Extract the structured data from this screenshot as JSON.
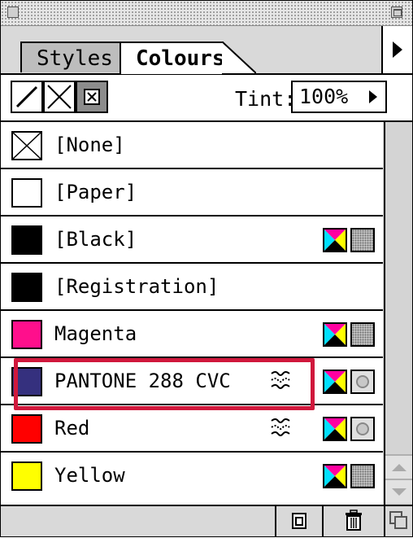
{
  "tabs": [
    {
      "label": "Styles",
      "active": false
    },
    {
      "label": "Colours",
      "active": true
    }
  ],
  "toolbar": {
    "tools": [
      "stroke-tool-icon",
      "no-fill-tool-icon",
      "fill-tool-icon"
    ],
    "tint_label": "Tint:",
    "tint_value": "100%"
  },
  "colours": [
    {
      "name": "[None]",
      "swatch": "none",
      "spot": false,
      "process": false,
      "mode": ""
    },
    {
      "name": "[Paper]",
      "swatch": "#ffffff",
      "spot": false,
      "process": false,
      "mode": ""
    },
    {
      "name": "[Black]",
      "swatch": "#000000",
      "spot": false,
      "process": true,
      "mode": "tone"
    },
    {
      "name": "[Registration]",
      "swatch": "#000000",
      "spot": false,
      "process": false,
      "mode": ""
    },
    {
      "name": "Magenta",
      "swatch": "#ff0f8c",
      "spot": false,
      "process": true,
      "mode": "tone"
    },
    {
      "name": "PANTONE 288 CVC",
      "swatch": "#35307e",
      "spot": true,
      "process": true,
      "mode": "dot",
      "highlighted": true
    },
    {
      "name": "Red",
      "swatch": "#ff0000",
      "spot": true,
      "process": true,
      "mode": "dot"
    },
    {
      "name": "Yellow",
      "swatch": "#ffff00",
      "spot": false,
      "process": true,
      "mode": "tone"
    }
  ],
  "highlight_color": "#d0183c",
  "footer": {
    "icons": [
      "new-colour-icon",
      "delete-colour-icon",
      "resize-grip-icon"
    ]
  }
}
